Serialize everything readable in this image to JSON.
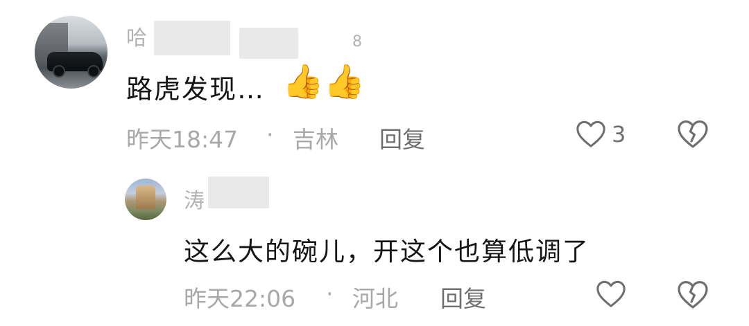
{
  "comments": [
    {
      "username": "哈",
      "username_suffix": "8",
      "text": "路虎发现…",
      "emoji": [
        "👍",
        "👍"
      ],
      "time": "昨天18:47",
      "separator": "·",
      "location": "吉林",
      "reply_label": "回复",
      "like_count": "3"
    },
    {
      "username": "涛",
      "text": "这么大的碗儿，开这个也算低调了",
      "time": "昨天22:06",
      "separator": "·",
      "location": "河北",
      "reply_label": "回复"
    }
  ],
  "icons": [
    "avatar",
    "heart-icon",
    "broken-heart-icon",
    "thumbs-up-emoji"
  ],
  "colors": {
    "text_primary": "#151515",
    "text_meta": "#a8a8a8",
    "text_secondary": "#6f6f6f",
    "icon": "#6f6f6f"
  }
}
